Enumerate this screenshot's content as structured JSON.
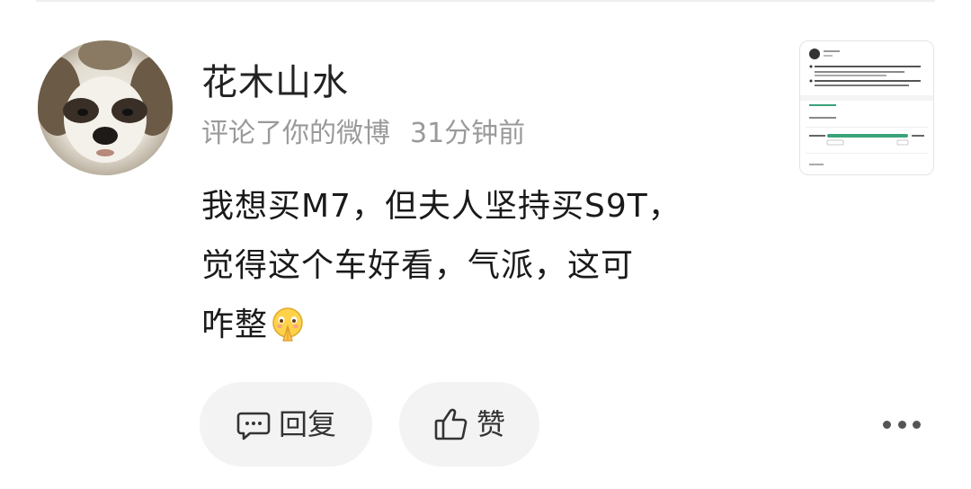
{
  "comment": {
    "username": "花木山水",
    "action": "评论了你的微博",
    "time": "31分钟前",
    "lines": [
      "我想买M7，但夫人坚持买S9T，",
      "觉得这个车好看，气派，这可",
      "咋整"
    ],
    "emoji": "pray-emoji"
  },
  "actions": {
    "reply_label": "回复",
    "like_label": "赞"
  },
  "icons": {
    "reply": "comment-bubble-icon",
    "like": "thumbs-up-icon",
    "more": "more-dots-icon"
  },
  "colors": {
    "username": "#222222",
    "meta": "#9a9a9a",
    "pill_bg": "#f3f3f3",
    "thumb_accent": "#3aa37a"
  }
}
